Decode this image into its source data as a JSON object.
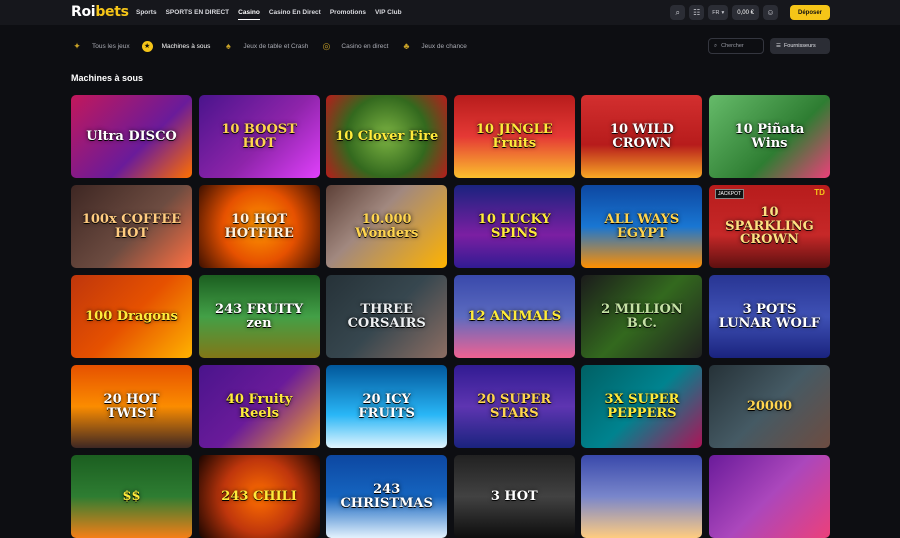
{
  "header": {
    "logo_main": "Roi",
    "logo_accent": "bets",
    "nav": [
      "Sports",
      "SPORTS EN DIRECT",
      "Casino",
      "Casino En Direct",
      "Promotions",
      "VIP Club"
    ],
    "lang": "FR",
    "balance": "0,00 €",
    "deposit_label": "Déposer"
  },
  "categories": [
    {
      "label": "Tous les jeux",
      "icon": "all-games-icon"
    },
    {
      "label": "Machines à sous",
      "icon": "slots-icon"
    },
    {
      "label": "Jeux de table et Crash",
      "icon": "table-games-icon"
    },
    {
      "label": "Casino en direct",
      "icon": "live-casino-icon"
    },
    {
      "label": "Jeux de chance",
      "icon": "luck-games-icon"
    }
  ],
  "search_placeholder": "Chercher",
  "providers_label": "Fournisseurs",
  "section_title": "Machines à sous",
  "games": [
    {
      "title": "Ultra DISCO",
      "bg": "linear-gradient(135deg,#c2185b,#6a1b9a 60%,#ff6f00)",
      "color": "#fff"
    },
    {
      "title": "10 BOOST HOT",
      "bg": "linear-gradient(135deg,#4a148c,#8e24aa 55%,#e040fb)",
      "color": "#ffd54f"
    },
    {
      "title": "10 Clover Fire",
      "bg": "radial-gradient(circle,#7cb342,#33691e 55%,#b71c1c)",
      "color": "#ffeb3b"
    },
    {
      "title": "10 JINGLE Fruits",
      "bg": "linear-gradient(180deg,#b71c1c,#e53935 50%,#fbc02d)",
      "color": "#ffeb3b"
    },
    {
      "title": "10 WILD CROWN",
      "bg": "linear-gradient(180deg,#d32f2f,#b71c1c 60%,#f9a825)",
      "color": "#fff"
    },
    {
      "title": "10 Piñata Wins",
      "bg": "linear-gradient(135deg,#66bb6a,#2e7d32 60%,#ec407a)",
      "color": "#fff"
    },
    {
      "title": "100x COFFEE HOT",
      "bg": "linear-gradient(135deg,#3e2723,#6d4c41 55%,#ff7043)",
      "color": "#ffcc80"
    },
    {
      "title": "10 HOT HOTFIRE",
      "bg": "radial-gradient(circle,#ff9800,#e65100 50%,#3e1000)",
      "color": "#fff3e0"
    },
    {
      "title": "10.000 Wonders",
      "bg": "linear-gradient(135deg,#5d4037,#a1887f 40%,#ffb300)",
      "color": "#ffd54f"
    },
    {
      "title": "10 LUCKY SPINS",
      "bg": "linear-gradient(180deg,#1a237e,#7b1fa2 60%,#311b92)",
      "color": "#ffeb3b"
    },
    {
      "title": "ALL WAYS EGYPT",
      "bg": "linear-gradient(180deg,#0d47a1,#1976d2 50%,#ff8f00)",
      "color": "#ffd54f"
    },
    {
      "title": "10 SPARKLING CROWN",
      "bg": "linear-gradient(180deg,#b71c1c,#c62828 60%,#5d1010)",
      "color": "#ffe082",
      "badge": "TD",
      "jackpot": "JACKPOT"
    },
    {
      "title": "100 Dragons",
      "bg": "linear-gradient(135deg,#bf360c,#e65100 50%,#ffb300)",
      "color": "#ffeb3b"
    },
    {
      "title": "243 FRUITY zen",
      "bg": "linear-gradient(180deg,#1b5e20,#43a047 50%,#827717)",
      "color": "#fff"
    },
    {
      "title": "THREE CORSAIRS",
      "bg": "linear-gradient(135deg,#263238,#37474f 50%,#8d6e63)",
      "color": "#eceff1"
    },
    {
      "title": "12 ANIMALS",
      "bg": "linear-gradient(180deg,#3949ab,#5c6bc0 50%,#f06292)",
      "color": "#ffeb3b"
    },
    {
      "title": "2 MILLION B.C.",
      "bg": "linear-gradient(135deg,#1b1b1b,#33691e 50%,#212121)",
      "color": "#c5e1a5"
    },
    {
      "title": "3 POTS LUNAR WOLF",
      "bg": "linear-gradient(180deg,#283593,#3f51b5 50%,#1a237e)",
      "color": "#fff"
    },
    {
      "title": "20 HOT TWIST",
      "bg": "linear-gradient(180deg,#e65100,#fb8c00 50%,#3e2723)",
      "color": "#fff"
    },
    {
      "title": "40 Fruity Reels",
      "bg": "linear-gradient(135deg,#4a148c,#6a1b9a 50%,#f9a825)",
      "color": "#ffeb3b"
    },
    {
      "title": "20 ICY FRUITS",
      "bg": "linear-gradient(180deg,#01579b,#29b6f6 60%,#e1f5fe)",
      "color": "#fff"
    },
    {
      "title": "20 SUPER STARS",
      "bg": "linear-gradient(180deg,#311b92,#5e35b1 50%,#1a237e)",
      "color": "#ffd54f"
    },
    {
      "title": "3X SUPER PEPPERS",
      "bg": "linear-gradient(135deg,#006064,#00838f 50%,#ad1457)",
      "color": "#ffeb3b"
    },
    {
      "title": "20000",
      "bg": "linear-gradient(135deg,#263238,#455a64 50%,#6d4c41)",
      "color": "#ffd54f"
    },
    {
      "title": "$$",
      "bg": "linear-gradient(180deg,#1b5e20,#2e7d32 50%,#f57f17)",
      "color": "#ffeb3b"
    },
    {
      "title": "243 CHILI",
      "bg": "radial-gradient(circle,#ff6f00,#bf360c 50%,#1a0500)",
      "color": "#ffeb3b"
    },
    {
      "title": "243 CHRISTMAS",
      "bg": "linear-gradient(180deg,#0d47a1,#1565c0 50%,#e3f2fd)",
      "color": "#fff"
    },
    {
      "title": "3 HOT",
      "bg": "linear-gradient(180deg,#212121,#424242 50%,#0d0d0d)",
      "color": "#fff"
    },
    {
      "title": "",
      "bg": "linear-gradient(180deg,#3949ab,#7986cb 50%,#ffcc80)",
      "color": "#fff"
    },
    {
      "title": "",
      "bg": "linear-gradient(135deg,#6a1b9a,#ab47bc 50%,#ec407a)",
      "color": "#ffeb3b"
    }
  ]
}
